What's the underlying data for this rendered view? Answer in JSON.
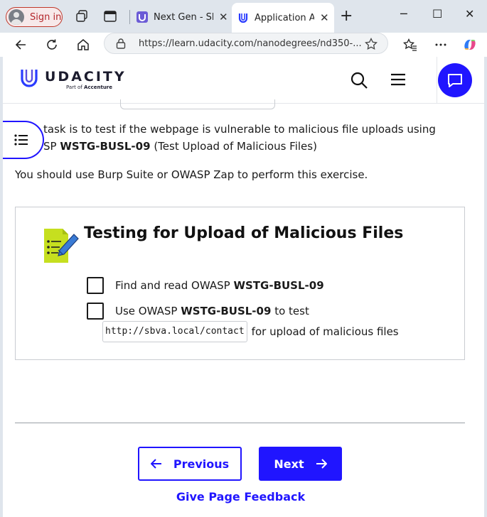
{
  "browser": {
    "signin_label": "Sign in",
    "tabs": [
      {
        "title": "Next Gen - Sha",
        "active": false
      },
      {
        "title": "Application Au",
        "active": true
      }
    ],
    "url": "https://learn.udacity.com/nanodegrees/nd350-..."
  },
  "header": {
    "logo_text": "UDACITY",
    "logo_sub_prefix": "Part of ",
    "logo_sub_brand": "Accenture",
    "accent_color": "#2015ff"
  },
  "content": {
    "intro_line1": "task is to test if the webpage is vulnerable to malicious file uploads using",
    "intro_line2_prefix": "SP ",
    "intro_line2_bold": "WSTG-BUSL-09",
    "intro_line2_suffix": " (Test Upload of Malicious Files)",
    "tool_line": "You should use Burp Suite or OWASP Zap to perform this exercise."
  },
  "card": {
    "title": "Testing for Upload of Malicious Files",
    "items": [
      {
        "prefix": "Find and read OWASP ",
        "bold": "WSTG-BUSL-09",
        "suffix": ""
      },
      {
        "prefix": "Use OWASP ",
        "bold": "WSTG-BUSL-09",
        "suffix": " to test"
      }
    ],
    "code": "http://sbva.local/contact",
    "code_suffix": "for upload of malicious files"
  },
  "footer": {
    "previous_label": "Previous",
    "next_label": "Next",
    "feedback_label": "Give Page Feedback"
  }
}
